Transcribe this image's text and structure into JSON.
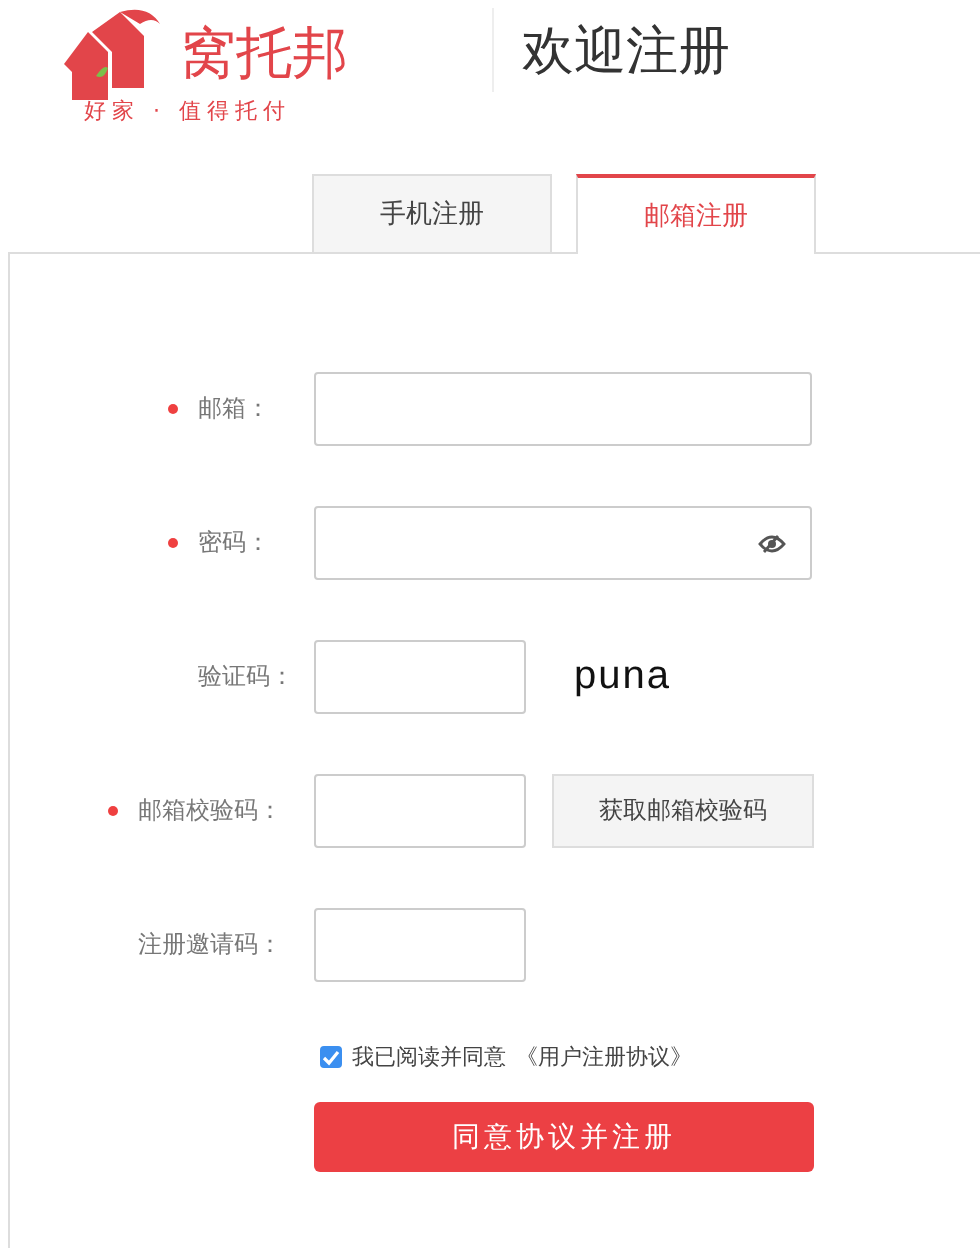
{
  "logo": {
    "name": "窝托邦",
    "slogan": "好家 · 值得托付"
  },
  "heading": "欢迎注册",
  "tabs": [
    {
      "label": "手机注册",
      "selected": false
    },
    {
      "label": "邮箱注册",
      "selected": true
    }
  ],
  "fields": [
    {
      "kind": "text",
      "label": "邮箱：",
      "required": true
    },
    {
      "kind": "password",
      "label": "密码：",
      "required": true
    },
    {
      "kind": "captcha",
      "label": "验证码：",
      "required": false,
      "captcha": "puna"
    },
    {
      "kind": "send_code",
      "label": "邮箱校验码：",
      "required": true,
      "button": "获取邮箱校验码"
    },
    {
      "kind": "short",
      "label": "注册邀请码：",
      "required": false
    }
  ],
  "agreement": {
    "checked": true,
    "text": "我已阅读并同意",
    "link": "《用户注册协议》"
  },
  "submit": "同意协议并注册"
}
